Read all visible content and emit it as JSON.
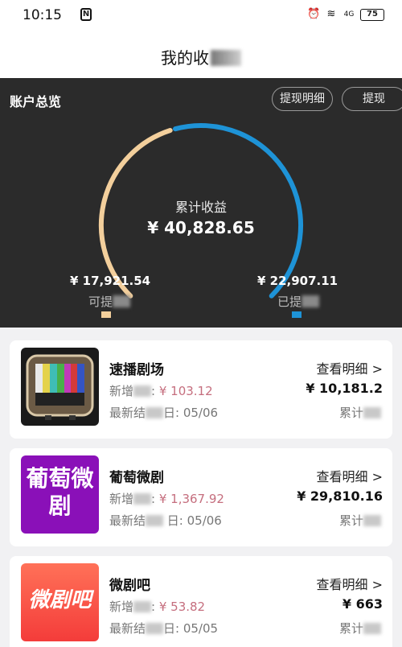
{
  "status": {
    "time": "10:15",
    "nfc": "N",
    "battery": "75",
    "signal_label": "4G"
  },
  "header": {
    "title": "我的收"
  },
  "overview": {
    "title": "账户总览",
    "btn_detail": "提现明细",
    "btn_withdraw": "提现",
    "total_label": "累计收益",
    "total_value": "¥ 40,828.65",
    "available_value": "¥ 17,921.54",
    "available_label": "可提",
    "withdrawn_value": "¥ 22,907.11",
    "withdrawn_label": "已提",
    "colors": {
      "available": "#f3cf9c",
      "withdrawn": "#1e93d7"
    },
    "withdrawn_fraction": 0.561
  },
  "cards": [
    {
      "name": "速播剧场",
      "new_label": "新增",
      "new_value": "¥ 103.12",
      "latest_label": "最新结",
      "latest_value": "05/06",
      "link": "查看明细 >",
      "total_value": "¥ 10,181.2",
      "total_label": "累计"
    },
    {
      "name": "葡萄微剧",
      "new_label": "新增",
      "new_value": "¥ 1,367.92",
      "latest_label": "最新结",
      "latest_value": "日: 05/06",
      "link": "查看明细 >",
      "total_value": "¥ 29,810.16",
      "total_label": "累计",
      "logo_text": "葡萄微剧"
    },
    {
      "name": "微剧吧",
      "new_label": "新增",
      "new_value": "¥ 53.82",
      "latest_label": "最新结",
      "latest_value": "05/05",
      "link": "查看明细 >",
      "total_value": "¥ 663",
      "total_label": "累计",
      "logo_text": "微剧吧"
    }
  ]
}
